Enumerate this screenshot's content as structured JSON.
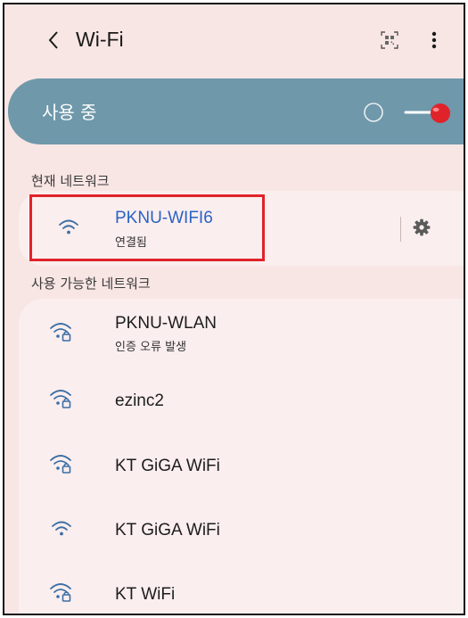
{
  "header": {
    "back_icon": "chevron-left-icon",
    "title": "Wi-Fi",
    "qr_icon": "qr-code-scanner-icon",
    "more_icon": "more-vertical-icon"
  },
  "wifi_toggle": {
    "label": "사용 중",
    "state": "on"
  },
  "current_network": {
    "section_label": "현재 네트워크",
    "name": "PKNU-WIFI6",
    "status": "연결됨",
    "icon": "wifi-icon",
    "settings_icon": "gear-icon",
    "name_color": "#2a63c4"
  },
  "available": {
    "section_label": "사용 가능한 네트워크",
    "networks": [
      {
        "name": "PKNU-WLAN",
        "status": "인증 오류 발생",
        "icon": "wifi-lock-icon"
      },
      {
        "name": "ezinc2",
        "status": "",
        "icon": "wifi-lock-icon"
      },
      {
        "name": "KT GiGA WiFi",
        "status": "",
        "icon": "wifi-lock-icon"
      },
      {
        "name": "KT GiGA WiFi",
        "status": "",
        "icon": "wifi-icon"
      },
      {
        "name": "KT WiFi",
        "status": "",
        "icon": "wifi-lock-icon"
      }
    ]
  },
  "colors": {
    "background": "#f8e6e4",
    "toggle_card": "#6f98aa",
    "accent_red": "#e0232a",
    "wifi_icon": "#3b6ea5"
  }
}
